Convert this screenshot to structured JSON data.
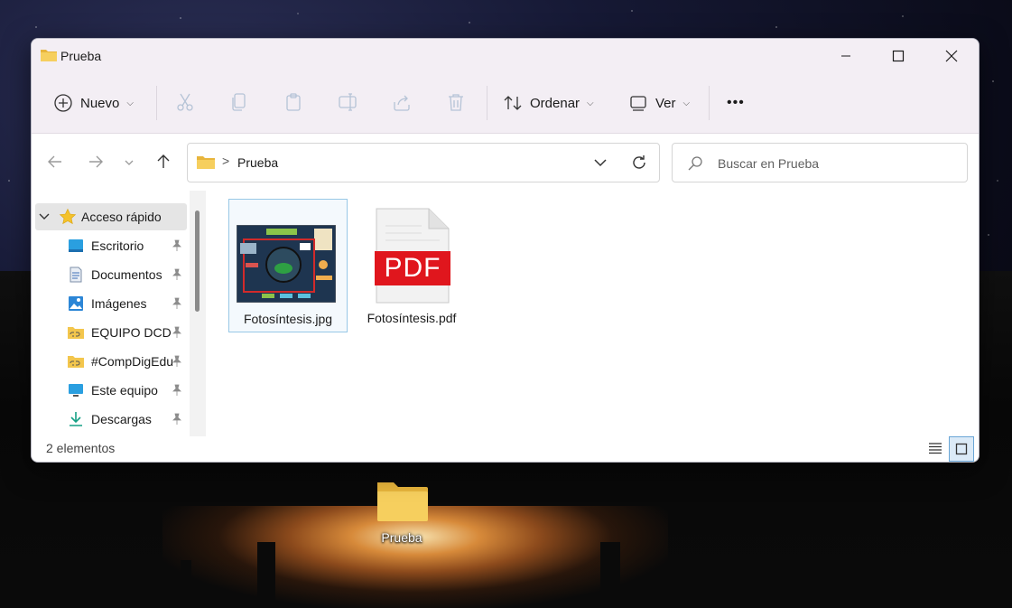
{
  "window": {
    "title": "Prueba"
  },
  "toolbar": {
    "new_label": "Nuevo",
    "sort_label": "Ordenar",
    "view_label": "Ver",
    "more_label": "•••"
  },
  "address": {
    "separator": ">",
    "path": "Prueba",
    "search_placeholder": "Buscar en Prueba"
  },
  "sidebar": {
    "quick_access": "Acceso rápido",
    "items": [
      {
        "label": "Escritorio",
        "icon": "desktop-icon"
      },
      {
        "label": "Documentos",
        "icon": "documents-icon"
      },
      {
        "label": "Imágenes",
        "icon": "pictures-icon"
      },
      {
        "label": "EQUIPO DCD",
        "icon": "folder-link-icon"
      },
      {
        "label": "#CompDigEdu",
        "icon": "folder-link-icon"
      },
      {
        "label": "Este equipo",
        "icon": "computer-icon"
      },
      {
        "label": "Descargas",
        "icon": "download-icon"
      }
    ]
  },
  "files": [
    {
      "name": "Fotosíntesis.jpg",
      "type": "image"
    },
    {
      "name": "Fotosíntesis.pdf",
      "type": "pdf",
      "badge": "PDF"
    }
  ],
  "status": {
    "count_text": "2 elementos"
  },
  "desktop": {
    "folder_label": "Prueba"
  },
  "colors": {
    "accent": "#0067c0",
    "folder": "#f3c64d",
    "pdf_red": "#e0161d"
  }
}
